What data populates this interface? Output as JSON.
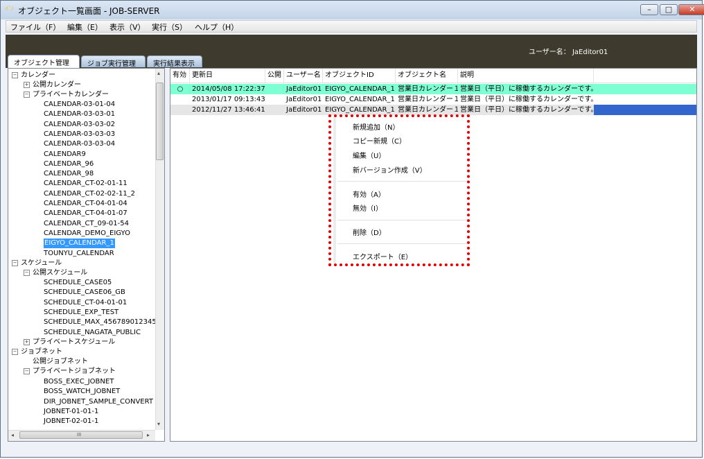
{
  "window": {
    "title": "オブジェクト一覧画面 - JOB-SERVER",
    "icon_text": "ﾊﾞﾝ",
    "controls": {
      "minimize": "–",
      "maximize": "□",
      "close": "✕"
    }
  },
  "menubar": [
    "ファイル（F）",
    "編集（E）",
    "表示（V）",
    "実行（S）",
    "ヘルプ（H）"
  ],
  "header": {
    "user": "ユーザー名： JaEditor01"
  },
  "tabs": [
    "オブジェクト管理",
    "ジョブ実行管理",
    "実行結果表示"
  ],
  "tree": {
    "calendar": "カレンダー",
    "public_calendar": "公開カレンダー",
    "private_calendar": "プライベートカレンダー",
    "calendars": [
      "CALENDAR-03-01-04",
      "CALENDAR-03-03-01",
      "CALENDAR-03-03-02",
      "CALENDAR-03-03-03",
      "CALENDAR-03-03-04",
      "CALENDAR9",
      "CALENDAR_96",
      "CALENDAR_98",
      "CALENDAR_CT-02-01-11",
      "CALENDAR_CT-02-02-11_2",
      "CALENDAR_CT-04-01-04",
      "CALENDAR_CT-04-01-07",
      "CALENDAR_CT_09-01-54",
      "CALENDAR_DEMO_EIGYO",
      "EIGYO_CALENDAR_1",
      "TOUNYU_CALENDAR"
    ],
    "schedule": "スケジュール",
    "public_schedule": "公開スケジュール",
    "schedules": [
      "SCHEDULE_CASE05",
      "SCHEDULE_CASE06_GB",
      "SCHEDULE_CT-04-01-01",
      "SCHEDULE_EXP_TEST",
      "SCHEDULE_MAX_4567890123456",
      "SCHEDULE_NAGATA_PUBLIC"
    ],
    "private_schedule": "プライベートスケジュール",
    "jobnet": "ジョブネット",
    "public_jobnet": "公開ジョブネット",
    "private_jobnet": "プライベートジョブネット",
    "jobnets": [
      "BOSS_EXEC_JOBNET",
      "BOSS_WATCH_JOBNET",
      "DIR_JOBNET_SAMPLE_CONVERT",
      "JOBNET-01-01-1",
      "JOBNET-02-01-1"
    ],
    "scroll": {
      "left": "◂",
      "right": "▸",
      "up": "▴",
      "down": "▾",
      "grip": "III"
    }
  },
  "table": {
    "headers": [
      "有効",
      "更新日",
      "公開",
      "ユーザー名",
      "オブジェクトID",
      "オブジェクト名",
      "説明"
    ],
    "rows": [
      {
        "valid": "○",
        "updated": "2014/05/08 17:22:37",
        "public": "",
        "user": "JaEditor01",
        "id": "EIGYO_CALENDAR_1",
        "name": "営業日カレンダー１",
        "desc": "営業日（平日）に稼働するカレンダーです。"
      },
      {
        "valid": "",
        "updated": "2013/01/17 09:13:43",
        "public": "",
        "user": "JaEditor01",
        "id": "EIGYO_CALENDAR_1",
        "name": "営業日カレンダー１",
        "desc": "営業日（平日）に稼働するカレンダーです。"
      },
      {
        "valid": "",
        "updated": "2012/11/27 13:46:41",
        "public": "",
        "user": "JaEditor01",
        "id": "EIGYO_CALENDAR_1",
        "name": "営業日カレンダー１",
        "desc": "営業日（平日）に稼働するカレンダーです。"
      }
    ]
  },
  "context_menu": {
    "new": "新規追加（N）",
    "copy_new": "コピー新規（C）",
    "edit": "編集（U）",
    "new_version": "新バージョン作成（V）",
    "enable": "有効（A）",
    "disable": "無効（I）",
    "delete": "削除（D）",
    "export": "エクスポート（E）"
  },
  "colors": {
    "valid_row": "#7fffd4",
    "selected_row": "#e6e6e6",
    "selection_bar": "#3366cc",
    "highlight_border": "#e00000",
    "header_bg": "#3f3a2e"
  }
}
